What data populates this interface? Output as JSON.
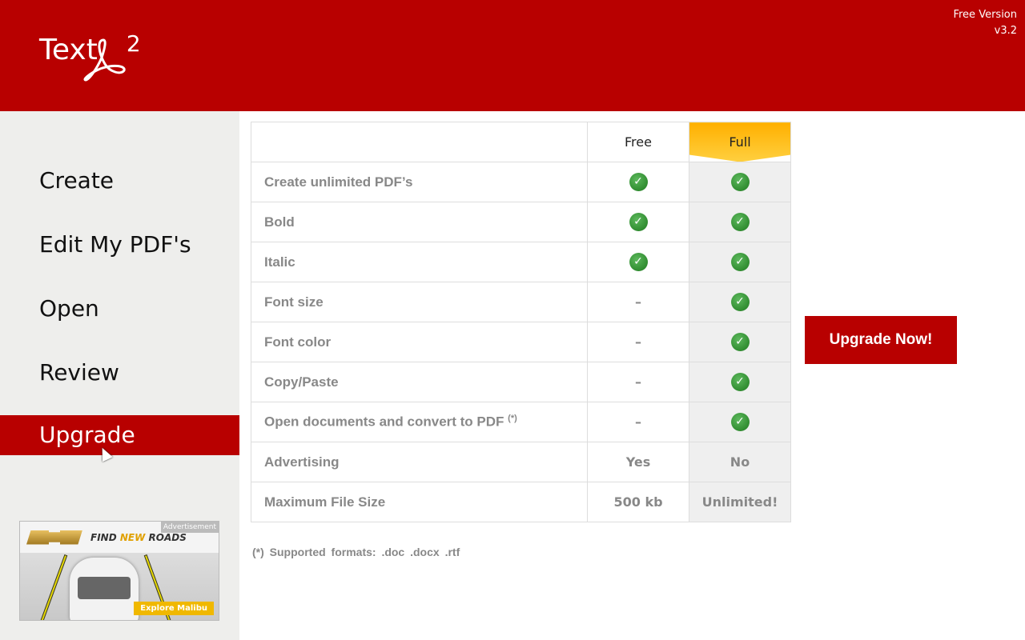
{
  "header": {
    "logo_text": "Text",
    "logo_sup": "2",
    "version_line1": "Free Version",
    "version_line2": "v3.2"
  },
  "sidebar": {
    "items": [
      {
        "label": "Create"
      },
      {
        "label": "Edit My PDF's"
      },
      {
        "label": "Open"
      },
      {
        "label": "Review"
      },
      {
        "label": "Upgrade"
      }
    ],
    "active": "Upgrade"
  },
  "ad": {
    "tag": "Advertisement",
    "slogan_a": "FIND ",
    "slogan_b": "NEW",
    "slogan_c": " ROADS",
    "cta": "Explore Malibu"
  },
  "table": {
    "columns": [
      "Free",
      "Full"
    ],
    "rows": [
      {
        "feature": "Create unlimited PDF’s",
        "free": "check",
        "full": "check"
      },
      {
        "feature": "Bold",
        "free": "check",
        "full": "check"
      },
      {
        "feature": "Italic",
        "free": "check",
        "full": "check"
      },
      {
        "feature": "Font size",
        "free": "–",
        "full": "check"
      },
      {
        "feature": "Font color",
        "free": "–",
        "full": "check"
      },
      {
        "feature": "Copy/Paste",
        "free": "–",
        "full": "check"
      },
      {
        "feature": "Open documents and convert to PDF",
        "sup": "(*)",
        "free": "–",
        "full": "check"
      },
      {
        "feature": "Advertising",
        "free": "Yes",
        "full": "No"
      },
      {
        "feature": "Maximum File Size",
        "free": "500 kb",
        "full": "Unlimited!"
      }
    ]
  },
  "footnote": "(*) Supported formats:  .doc  .docx  .rtf",
  "upgrade_button": "Upgrade Now!",
  "colors": {
    "brand": "#b80000",
    "check": "#2e8b2e",
    "highlight": "#ffc020"
  }
}
